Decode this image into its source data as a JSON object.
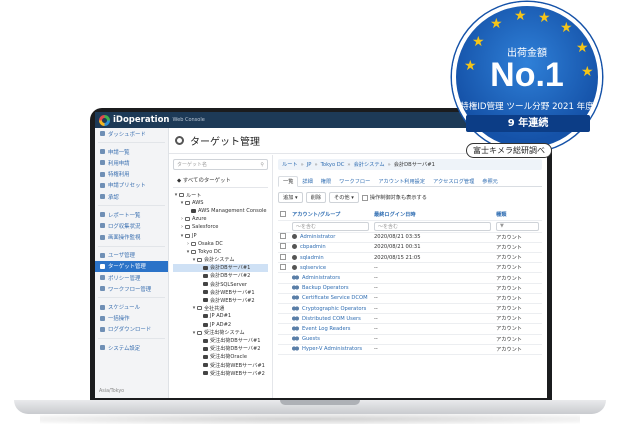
{
  "app": {
    "logo_text": "iDoperation",
    "logo_sub": "Web Console"
  },
  "sidebar": {
    "items": [
      {
        "label": "ダッシュボード",
        "icon": "home-icon"
      },
      {
        "label": "申請一覧",
        "icon": "list-icon"
      },
      {
        "label": "利用申請",
        "icon": "doc-icon"
      },
      {
        "label": "特権利用",
        "icon": "key-icon"
      },
      {
        "label": "申請プリセット",
        "icon": "bookmark-icon"
      },
      {
        "label": "承認",
        "icon": "check-icon"
      },
      {
        "label": "レポート一覧",
        "icon": "report-icon"
      },
      {
        "label": "ログ収集状況",
        "icon": "log-icon"
      },
      {
        "label": "画面操作監視",
        "icon": "monitor-icon"
      },
      {
        "label": "ユーザ管理",
        "icon": "user-icon"
      },
      {
        "label": "ターゲット管理",
        "icon": "target-icon"
      },
      {
        "label": "ポリシー管理",
        "icon": "policy-icon"
      },
      {
        "label": "ワークフロー管理",
        "icon": "workflow-icon"
      },
      {
        "label": "スケジュール",
        "icon": "calendar-icon"
      },
      {
        "label": "一括操作",
        "icon": "batch-icon"
      },
      {
        "label": "ログダウンロード",
        "icon": "download-icon"
      },
      {
        "label": "システム設定",
        "icon": "wrench-icon"
      }
    ],
    "active_index": 10,
    "footer": "Asia/Tokyo"
  },
  "page": {
    "title": "ターゲット管理"
  },
  "tree": {
    "search_placeholder": "ターゲット名",
    "all_label": "すべてのターゲット",
    "nodes": [
      {
        "label": "ルート",
        "depth": 0,
        "twisty": "▾",
        "kind": "folder"
      },
      {
        "label": "AWS",
        "depth": 1,
        "twisty": "▾",
        "kind": "folder"
      },
      {
        "label": "AWS Management Console",
        "depth": 2,
        "twisty": "",
        "kind": "server"
      },
      {
        "label": "Azure",
        "depth": 1,
        "twisty": "›",
        "kind": "folder"
      },
      {
        "label": "Salesforce",
        "depth": 1,
        "twisty": "›",
        "kind": "folder"
      },
      {
        "label": "JP",
        "depth": 1,
        "twisty": "▾",
        "kind": "folder"
      },
      {
        "label": "Osaka DC",
        "depth": 2,
        "twisty": "›",
        "kind": "folder"
      },
      {
        "label": "Tokyo DC",
        "depth": 2,
        "twisty": "▾",
        "kind": "folder"
      },
      {
        "label": "会計システム",
        "depth": 3,
        "twisty": "▾",
        "kind": "folder"
      },
      {
        "label": "会計DBサーバ#1",
        "depth": 4,
        "twisty": "",
        "kind": "server",
        "selected": true
      },
      {
        "label": "会計DBサーバ#2",
        "depth": 4,
        "twisty": "",
        "kind": "server"
      },
      {
        "label": "会計SQLServer",
        "depth": 4,
        "twisty": "",
        "kind": "server"
      },
      {
        "label": "会計WEBサーバ#1",
        "depth": 4,
        "twisty": "",
        "kind": "server"
      },
      {
        "label": "会計WEBサーバ#2",
        "depth": 4,
        "twisty": "",
        "kind": "server"
      },
      {
        "label": "全社共通",
        "depth": 3,
        "twisty": "▾",
        "kind": "folder"
      },
      {
        "label": "JP AD#1",
        "depth": 4,
        "twisty": "",
        "kind": "server"
      },
      {
        "label": "JP AD#2",
        "depth": 4,
        "twisty": "",
        "kind": "server"
      },
      {
        "label": "受注出荷システム",
        "depth": 3,
        "twisty": "▾",
        "kind": "folder"
      },
      {
        "label": "受注出荷DBサーバ#1",
        "depth": 4,
        "twisty": "",
        "kind": "server"
      },
      {
        "label": "受注出荷DBサーバ#2",
        "depth": 4,
        "twisty": "",
        "kind": "server"
      },
      {
        "label": "受注出荷Oracle",
        "depth": 4,
        "twisty": "",
        "kind": "server"
      },
      {
        "label": "受注出荷WEBサーバ#1",
        "depth": 4,
        "twisty": "",
        "kind": "server"
      },
      {
        "label": "受注出荷WEBサーバ#2",
        "depth": 4,
        "twisty": "",
        "kind": "server"
      }
    ]
  },
  "breadcrumb": [
    "ルート",
    "JP",
    "Tokyo DC",
    "会計システム",
    "会計DBサーバ#1"
  ],
  "tabs": [
    {
      "label": "一覧",
      "active": true
    },
    {
      "label": "詳細"
    },
    {
      "label": "権限"
    },
    {
      "label": "ワークフロー"
    },
    {
      "label": "アカウント利用設定"
    },
    {
      "label": "アクセスログ管理"
    },
    {
      "label": "参照元"
    }
  ],
  "toolbar": {
    "add_label": "追加 ▾",
    "delete_label": "削除",
    "other_label": "その他 ▾",
    "checkbox_label": "操作制御対象も表示する"
  },
  "table": {
    "headers": [
      "アカウント/グループ",
      "最終ログイン日時",
      "種類"
    ],
    "filter_placeholder": "〜を含む",
    "rows": [
      {
        "name": "Administrator",
        "last_login": "2020/08/21 03:35",
        "type": "アカウント",
        "kind": "user"
      },
      {
        "name": "cbpadmin",
        "last_login": "2020/08/21 00:31",
        "type": "アカウント",
        "kind": "user"
      },
      {
        "name": "sqladmin",
        "last_login": "2020/08/15 21:05",
        "type": "アカウント",
        "kind": "user"
      },
      {
        "name": "sqlservice",
        "last_login": "--",
        "type": "アカウント",
        "kind": "user"
      },
      {
        "name": "Administrators",
        "last_login": "--",
        "type": "アカウント",
        "kind": "group"
      },
      {
        "name": "Backup Operators",
        "last_login": "--",
        "type": "アカウント",
        "kind": "group"
      },
      {
        "name": "Certificate Service DCOM",
        "last_login": "--",
        "type": "アカウント",
        "kind": "group"
      },
      {
        "name": "Cryptographic Operators",
        "last_login": "--",
        "type": "アカウント",
        "kind": "group"
      },
      {
        "name": "Distributed COM Users",
        "last_login": "--",
        "type": "アカウント",
        "kind": "group"
      },
      {
        "name": "Event Log Readers",
        "last_login": "--",
        "type": "アカウント",
        "kind": "group"
      },
      {
        "name": "Guests",
        "last_login": "--",
        "type": "アカウント",
        "kind": "group"
      },
      {
        "name": "Hyper-V Administrators",
        "last_login": "--",
        "type": "アカウント",
        "kind": "group"
      }
    ]
  },
  "badge": {
    "top": "出荷金額",
    "rank": "No.1",
    "line": "特権ID管理 ツール分野 2021 年度",
    "ribbon": "9 年連続",
    "source": "富士キメラ総研調べ",
    "color": "#1552a8",
    "star_color": "#f5c518"
  }
}
